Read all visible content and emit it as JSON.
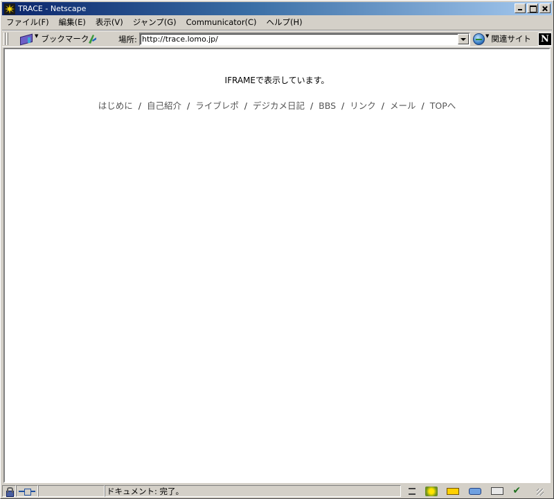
{
  "window": {
    "title": "TRACE - Netscape"
  },
  "menubar": {
    "items": [
      "ファイル(F)",
      "編集(E)",
      "表示(V)",
      "ジャンプ(G)",
      "Communicator(C)",
      "ヘルプ(H)"
    ]
  },
  "toolbar": {
    "bookmarks_label": "ブックマーク",
    "location_label": "場所:",
    "url": "http://trace.lomo.jp/",
    "related_label": "関連サイト",
    "logo_letter": "N"
  },
  "content": {
    "iframe_message": "IFRAMEで表示しています。",
    "nav_links": [
      "はじめに",
      "自己紹介",
      "ライブレポ",
      "デジカメ日記",
      "BBS",
      "リンク",
      "メール",
      "TOPへ"
    ],
    "nav_separator": "/"
  },
  "statusbar": {
    "status_text": "ドキュメント: 完了。"
  },
  "colors": {
    "chrome": "#d4d0c8",
    "titlebar_start": "#0a246a",
    "titlebar_end": "#a6caf0",
    "nav_link": "#555555"
  }
}
